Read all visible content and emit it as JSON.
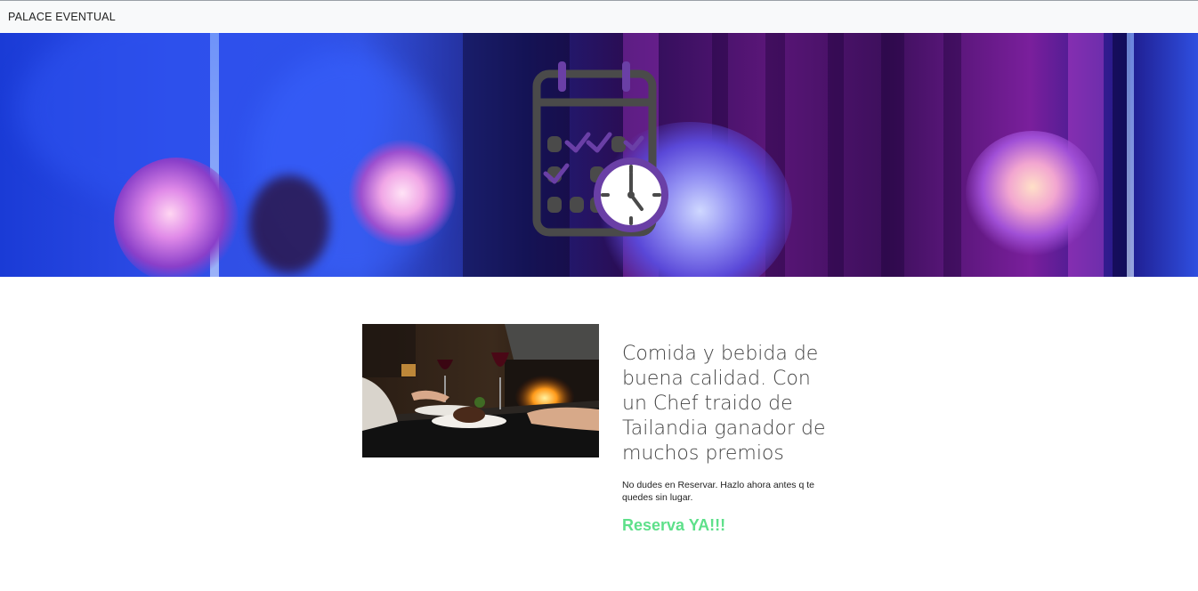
{
  "navbar": {
    "brand": "PALACE EVENTUAL"
  },
  "hero": {
    "icon": "calendar-clock-icon",
    "colors": {
      "icon_gray": "#4a4a4a",
      "icon_purple": "#6a3fa6"
    }
  },
  "feature": {
    "image": "restaurant-dinner-photo",
    "headline": "Comida y bebida de buena calidad. Con un Chef traido de Tailandia ganador de muchos premios",
    "subtext": "No dudes en Reservar. Hazlo ahora antes q te quedes sin lugar.",
    "cta_label": "Reserva YA!!!",
    "cta_color": "#5ee08a"
  }
}
